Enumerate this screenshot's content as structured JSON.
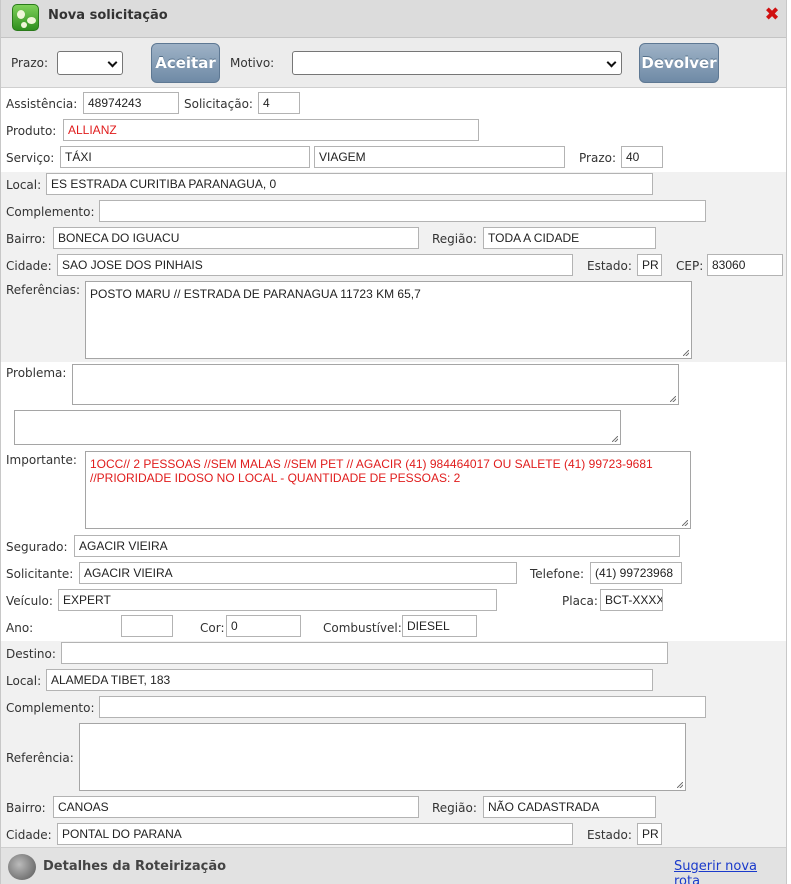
{
  "window": {
    "title": "Nova solicitação"
  },
  "toolbar": {
    "prazo_label": "Prazo:",
    "prazo_value": "",
    "aceitar_label": "Aceitar",
    "motivo_label": "Motivo:",
    "motivo_value": "",
    "devolver_label": "Devolver"
  },
  "form": {
    "assistencia_label": "Assistência:",
    "assistencia": "48974243",
    "solicitacao_label": "Solicitação:",
    "solicitacao": "4",
    "produto_label": "Produto:",
    "produto": "ALLIANZ",
    "servico_label": "Serviço:",
    "servico": "TÁXI",
    "servico_tipo": "VIAGEM",
    "prazo_label": "Prazo:",
    "prazo": "40",
    "local_label": "Local:",
    "local": "ES ESTRADA CURITIBA PARANAGUA, 0",
    "complemento_label": "Complemento:",
    "complemento": "",
    "bairro_label": "Bairro:",
    "bairro": "BONECA DO IGUACU",
    "regiao_label": "Região:",
    "regiao": "TODA A CIDADE",
    "cidade_label": "Cidade:",
    "cidade": "SAO JOSE DOS PINHAIS",
    "estado_label": "Estado:",
    "estado": "PR",
    "cep_label": "CEP:",
    "cep": "83060",
    "referencias_label": "Referências:",
    "referencias": "POSTO MARU // ESTRADA DE PARANAGUA 11723 KM 65,7",
    "problema_label": "Problema:",
    "problema": "",
    "problema_detalhe": "",
    "importante_label": "Importante:",
    "importante": "1OCC// 2 PESSOAS //SEM MALAS //SEM PET // AGACIR (41) 984464017 OU  SALETE (41) 99723-9681 //PRIORIDADE IDOSO NO LOCAL - QUANTIDADE DE PESSOAS: 2",
    "segurado_label": "Segurado:",
    "segurado": "AGACIR VIEIRA",
    "solicitante_label": "Solicitante:",
    "solicitante": "AGACIR VIEIRA",
    "telefone_label": "Telefone:",
    "telefone": "(41) 99723968",
    "veiculo_label": "Veículo:",
    "veiculo": "EXPERT",
    "placa_label": "Placa:",
    "placa": "BCT-XXXX",
    "ano_label": "Ano:",
    "ano": "",
    "cor_label": "Cor:",
    "cor": "0",
    "combustivel_label": "Combustível:",
    "combustivel": "DIESEL"
  },
  "destino": {
    "destino_label": "Destino:",
    "destino": "",
    "local_label": "Local:",
    "local": "ALAMEDA TIBET, 183",
    "complemento_label": "Complemento:",
    "complemento": "",
    "referencia_label": "Referência:",
    "referencia": "",
    "bairro_label": "Bairro:",
    "bairro": "CANOAS",
    "regiao_label": "Região:",
    "regiao": "NÃO CADASTRADA",
    "cidade_label": "Cidade:",
    "cidade": "PONTAL DO PARANA",
    "estado_label": "Estado:",
    "estado": "PR"
  },
  "footer": {
    "title": "Detalhes da Roteirização",
    "link": "Sugerir nova rota"
  },
  "colors": {
    "required_text": "#e01c1c",
    "button": "#7d95ae",
    "close": "#d01010",
    "link": "#1a3acb"
  }
}
